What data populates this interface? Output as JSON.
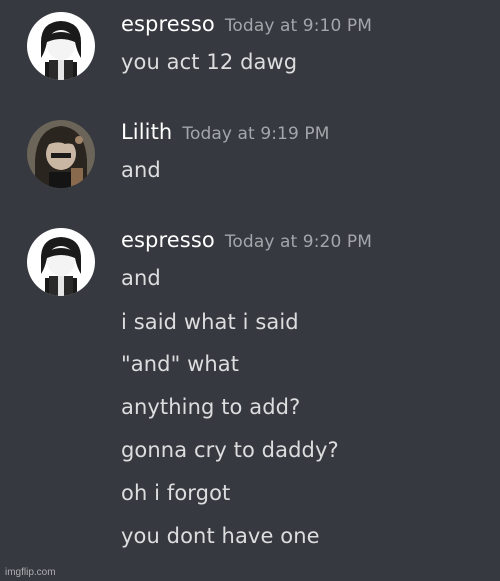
{
  "messages": [
    {
      "username": "espresso",
      "timestamp": "Today at 9:10 PM",
      "avatar": "espresso-avatar",
      "lines": [
        "you act 12 dawg"
      ]
    },
    {
      "username": "Lilith",
      "timestamp": "Today at 9:19 PM",
      "avatar": "lilith-avatar",
      "lines": [
        "and"
      ]
    },
    {
      "username": "espresso",
      "timestamp": "Today at 9:20 PM",
      "avatar": "espresso-avatar",
      "lines": [
        "and",
        "i said what i said",
        "\"and\" what",
        "anything to add?",
        "gonna cry to daddy?",
        "oh i forgot",
        "you dont have one"
      ]
    }
  ],
  "watermark": "imgflip.com",
  "colors": {
    "background": "#36393f",
    "username": "#ffffff",
    "timestamp": "#a3a6aa",
    "message_text": "#dcddde"
  }
}
